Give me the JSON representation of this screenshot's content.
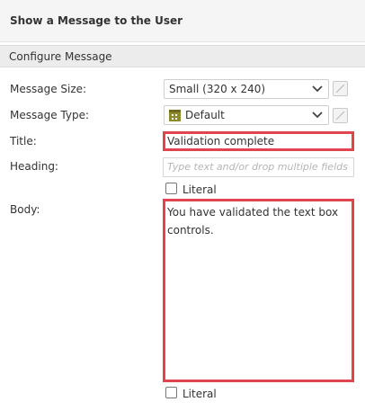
{
  "header": {
    "title": "Show a Message to the User"
  },
  "section": {
    "title": "Configure Message"
  },
  "fields": {
    "message_size": {
      "label": "Message Size:",
      "value": "Small (320 x 240)"
    },
    "message_type": {
      "label": "Message Type:",
      "value": "Default",
      "icon": "grid-table-icon"
    },
    "title": {
      "label": "Title:",
      "value": "Validation complete"
    },
    "heading": {
      "label": "Heading:",
      "placeholder": "Type text and/or drop multiple fields"
    },
    "heading_literal": {
      "label": "Literal",
      "checked": false
    },
    "body": {
      "label": "Body:",
      "value": "You have validated the text box controls."
    },
    "body_literal": {
      "label": "Literal",
      "checked": false
    }
  },
  "colors": {
    "highlight_border": "#e0444e",
    "section_bg": "#ececec",
    "header_bg": "#f5f5f5"
  }
}
